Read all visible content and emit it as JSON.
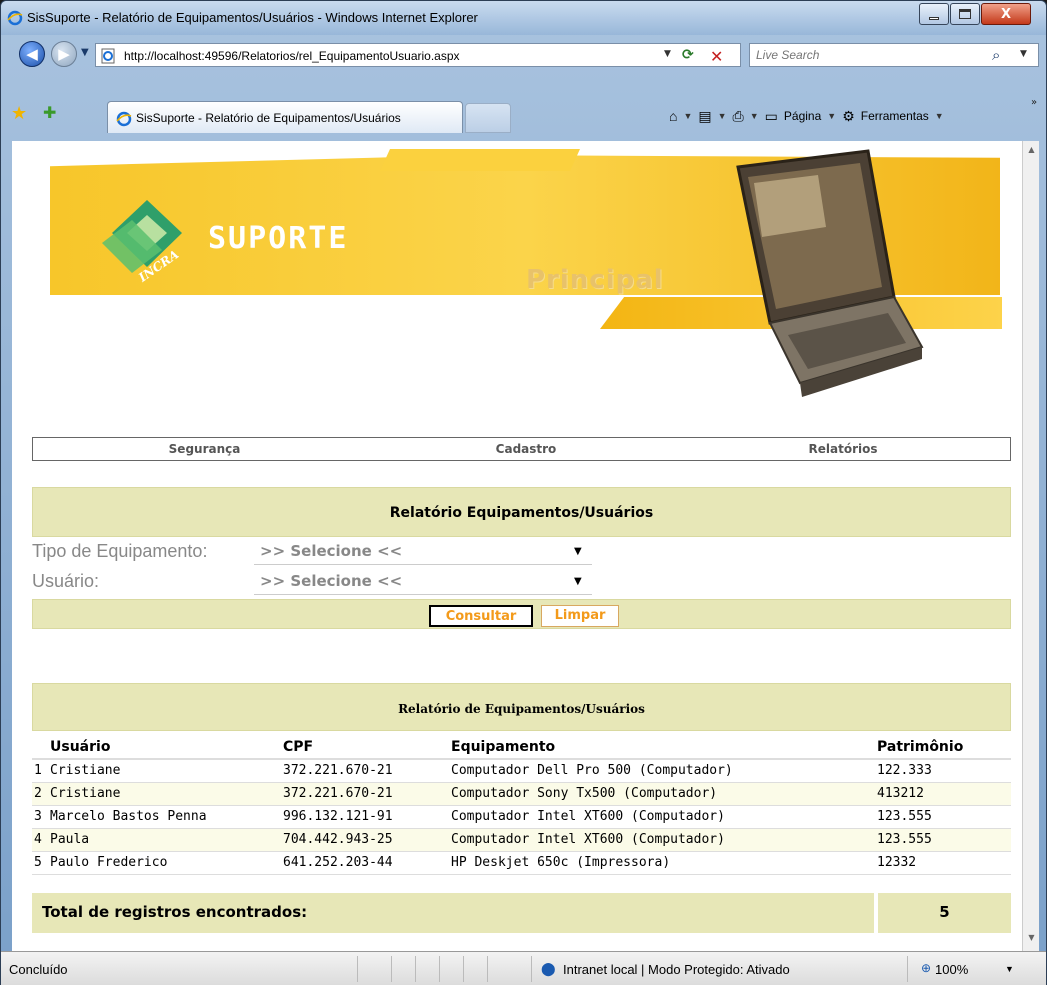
{
  "window": {
    "title": "SisSuporte - Relatório de Equipamentos/Usuários - Windows Internet Explorer",
    "close_label": "X"
  },
  "address": {
    "url": "http://localhost:49596/Relatorios/rel_EquipamentoUsuario.aspx",
    "search_placeholder": "Live Search"
  },
  "tab": {
    "label": "SisSuporte - Relatório de Equipamentos/Usuários"
  },
  "commandbar": {
    "page_label": "Página",
    "tools_label": "Ferramentas"
  },
  "banner": {
    "logo_text": "SUPORTE",
    "logo_sub": "INCRA",
    "section": "Principal"
  },
  "menu": {
    "items": [
      "Segurança",
      "Cadastro",
      "Relatórios"
    ]
  },
  "form": {
    "header": "Relatório Equipamentos/Usuários",
    "tipo_label": "Tipo de Equipamento:",
    "tipo_value": ">> Selecione <<",
    "usuario_label": "Usuário:",
    "usuario_value": ">> Selecione <<",
    "consultar_label": "Consultar",
    "limpar_label": "Limpar"
  },
  "report": {
    "title": "Relatório de Equipamentos/Usuários",
    "columns": [
      "Usuário",
      "CPF",
      "Equipamento",
      "Patrimônio"
    ],
    "rows": [
      {
        "num": "1",
        "usuario": "Cristiane",
        "cpf": "372.221.670-21",
        "equipamento": "Computador Dell Pro 500 (Computador)",
        "patrimonio": "122.333"
      },
      {
        "num": "2",
        "usuario": "Cristiane",
        "cpf": "372.221.670-21",
        "equipamento": "Computador Sony Tx500 (Computador)",
        "patrimonio": "413212"
      },
      {
        "num": "3",
        "usuario": "Marcelo Bastos Penna",
        "cpf": "996.132.121-91",
        "equipamento": "Computador Intel XT600 (Computador)",
        "patrimonio": "123.555"
      },
      {
        "num": "4",
        "usuario": "Paula",
        "cpf": "704.442.943-25",
        "equipamento": "Computador Intel XT600 (Computador)",
        "patrimonio": "123.555"
      },
      {
        "num": "5",
        "usuario": "Paulo Frederico",
        "cpf": "641.252.203-44",
        "equipamento": "HP Deskjet 650c (Impressora)",
        "patrimonio": "12332"
      }
    ],
    "total_label": "Total de registros encontrados:",
    "total_value": "5"
  },
  "status": {
    "text": "Concluído",
    "zone": "Intranet local | Modo Protegido: Ativado",
    "zoom": "100%"
  },
  "colors": {
    "accent_bg": "#e7e7b7",
    "button_text": "#f39a1a",
    "banner_yellow": "#f7c62a"
  }
}
